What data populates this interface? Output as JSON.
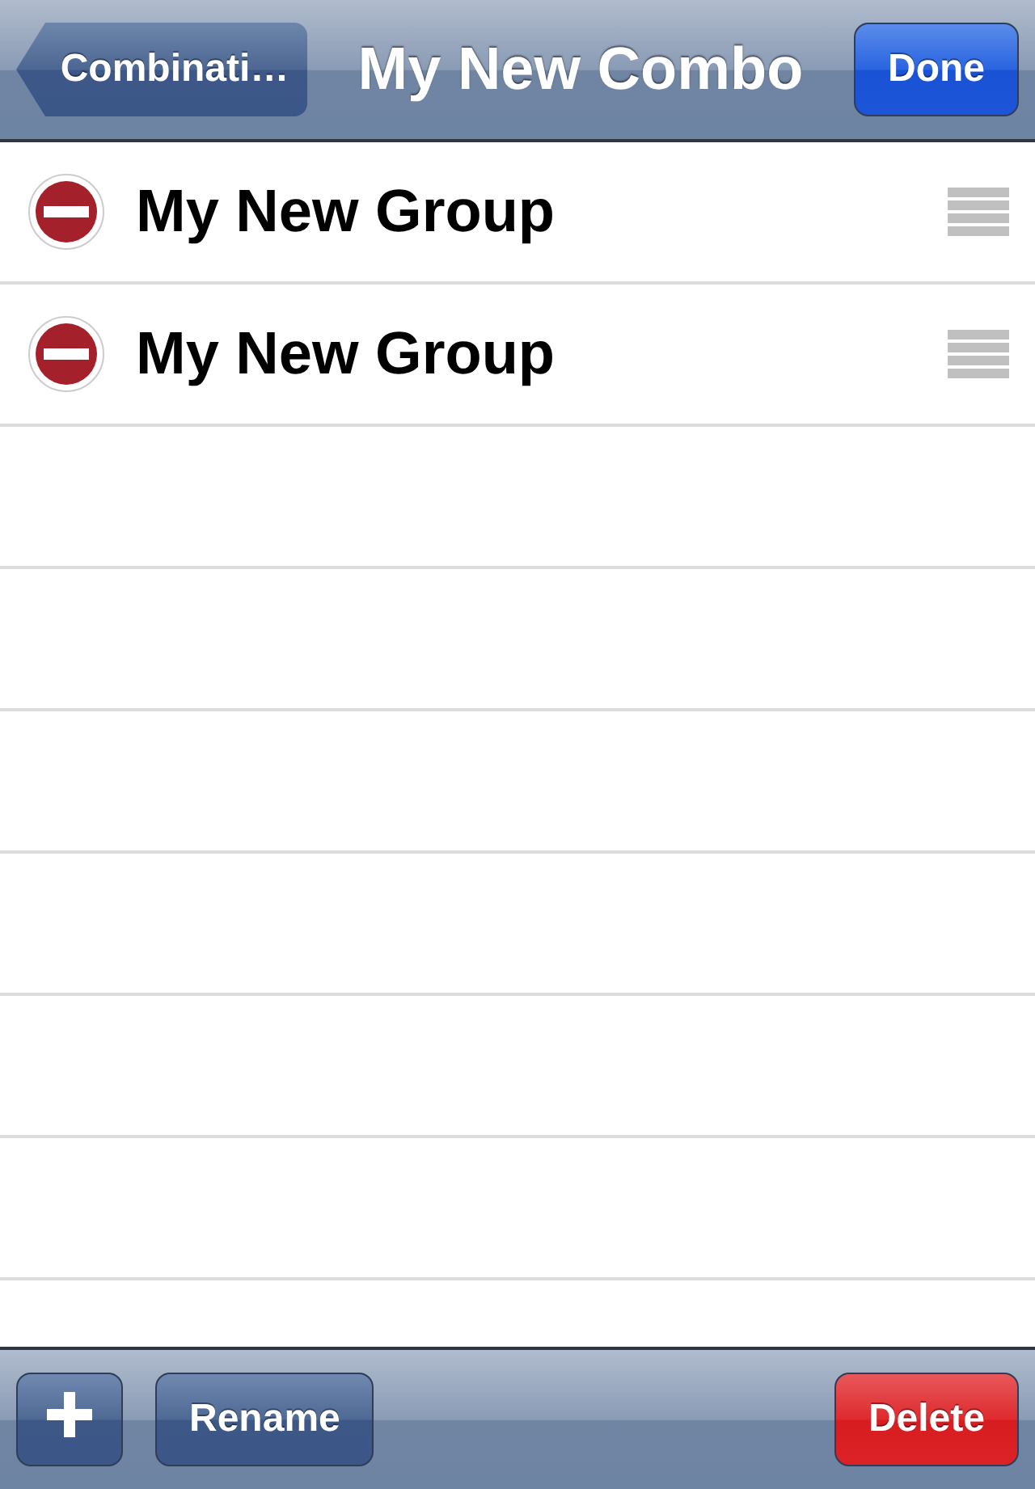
{
  "nav_bar": {
    "back_button": "Combinati…",
    "title": "My New Combo",
    "done_button": "Done"
  },
  "rows": [
    {
      "label": "My New Group"
    },
    {
      "label": "My New Group"
    }
  ],
  "toolbar": {
    "rename_button": "Rename",
    "delete_button": "Delete"
  }
}
